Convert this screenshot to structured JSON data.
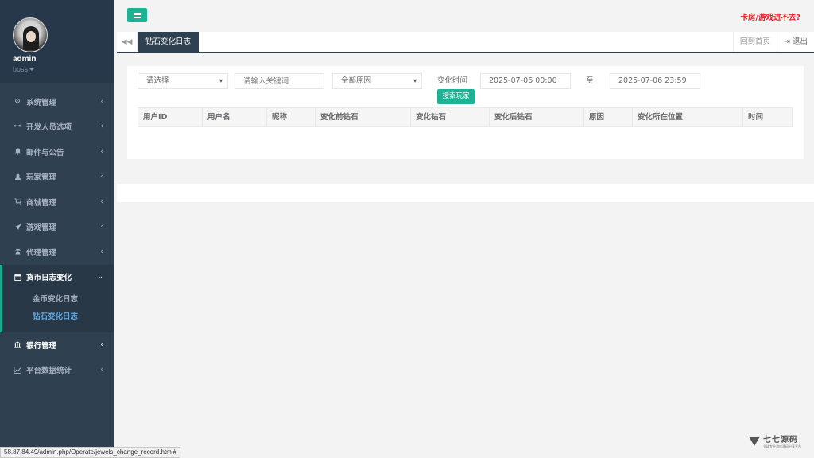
{
  "profile": {
    "name": "admin",
    "role": "boss"
  },
  "sidebar": {
    "items": [
      {
        "label": "系统管理",
        "icon": "gears-icon"
      },
      {
        "label": "开发人员选项",
        "icon": "gamepad-icon"
      },
      {
        "label": "邮件与公告",
        "icon": "bell-icon"
      },
      {
        "label": "玩家管理",
        "icon": "user-icon"
      },
      {
        "label": "商城管理",
        "icon": "cart-icon"
      },
      {
        "label": "游戏管理",
        "icon": "rocket-icon"
      },
      {
        "label": "代理管理",
        "icon": "user-secret-icon"
      },
      {
        "label": "货币日志变化",
        "icon": "calendar-icon"
      },
      {
        "label": "银行管理",
        "icon": "bank-icon"
      },
      {
        "label": "平台数据统计",
        "icon": "line-chart-icon"
      }
    ],
    "submenu": [
      {
        "label": "金币变化日志"
      },
      {
        "label": "钻石变化日志"
      }
    ]
  },
  "topbar": {
    "warning": "卡房/游戏进不去?"
  },
  "tabs": {
    "active": "钻石变化日志",
    "home": "回到首页",
    "logout": "退出"
  },
  "filters": {
    "select1": "请选择",
    "keyword_placeholder": "请输入关键词",
    "reason": "全部原因",
    "time_label": "变化时间",
    "start_time": "2025-07-06 00:00",
    "to_label": "至",
    "end_time": "2025-07-06 23:59",
    "search_button": "搜索玩家"
  },
  "table": {
    "headers": [
      "用户ID",
      "用户名",
      "昵称",
      "变化前钻石",
      "变化钻石",
      "变化后钻石",
      "原因",
      "变化所在位置",
      "时间"
    ]
  },
  "statusbar": {
    "url": "58.87.84.49/admin.php/Operate/jewels_change_record.html#"
  },
  "watermark": {
    "title": "七七源码",
    "subtitle": "全球专业游戏源码分享平台"
  }
}
